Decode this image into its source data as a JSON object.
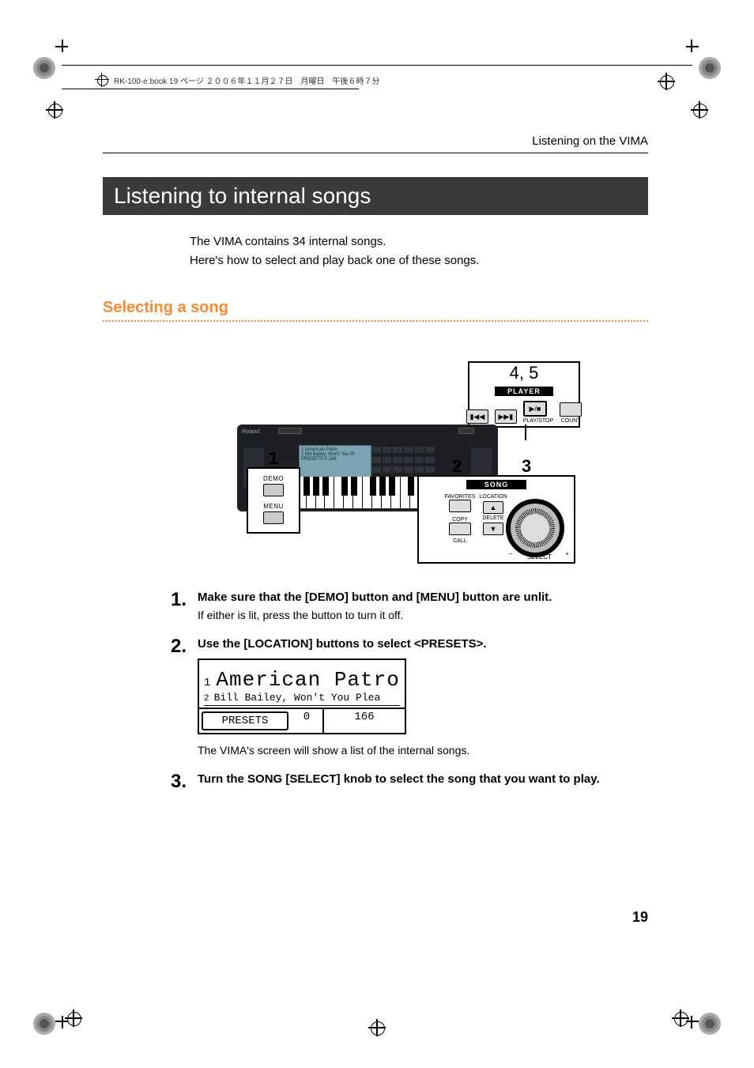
{
  "meta": {
    "header_line": "RK-100-e.book  19 ページ  ２００６年１１月２７日　月曜日　午後６時７分"
  },
  "running_head": "Listening on the VIMA",
  "section_title": "Listening to internal songs",
  "intro_line1": "The VIMA contains 34 internal songs.",
  "intro_line2": "Here's how to select and play back one of these songs.",
  "subsection": "Selecting a song",
  "diagram": {
    "callout_1": "1",
    "callout_2": "2",
    "callout_3": "3",
    "callout_45": "4, 5",
    "box1_demo": "DEMO",
    "box1_menu": "MENU",
    "box23_title": "SONG",
    "box23_favorites": "FAVORITES",
    "box23_location": "LOCATION",
    "box23_copy": "COPY",
    "box23_delete": "DELETE",
    "box23_call": "CALL",
    "box23_select": "SELECT",
    "box23_minus": "−",
    "box23_plus": "+",
    "box45_title": "PLAYER",
    "box45_playstop": "PLAY/STOP",
    "box45_count": "COUNT",
    "box45_rew_glyph": "▮◀◀",
    "box45_ff_glyph": "▶▶▮",
    "box45_ps_glyph": "▶/■",
    "kb_brand": "Roland",
    "kb_screen_l1": "1 American Patro",
    "kb_screen_l2": "2 Bill Bailey, Won't You Pl",
    "kb_screen_l3": "PRESETS  0  166"
  },
  "steps": [
    {
      "n": "1",
      "title": "Make sure that the [DEMO] button and [MENU] button are unlit.",
      "desc": "If either is lit, press the button to turn it off."
    },
    {
      "n": "2",
      "title": "Use the [LOCATION] buttons to select <PRESETS>.",
      "lcd": {
        "line1_idx": "1",
        "line1_txt": "American Patro",
        "line2_idx": "2",
        "line2_txt": "Bill Bailey, Won't You Plea",
        "presets": "PRESETS",
        "zero": "0",
        "len": "166"
      },
      "after": "The VIMA's screen will show a list of the internal songs."
    },
    {
      "n": "3",
      "title": "Turn the SONG [SELECT] knob to select the song that you want to play."
    }
  ],
  "page_number": "19"
}
